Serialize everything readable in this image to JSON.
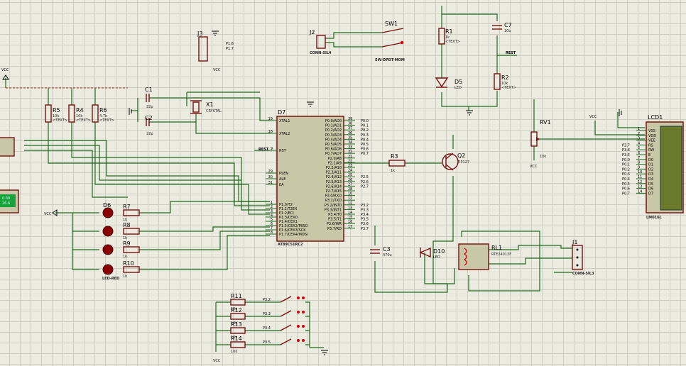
{
  "components": [
    {
      "ref": "R1",
      "value": "1k"
    },
    {
      "ref": "R2",
      "value": "10k"
    },
    {
      "ref": "R3",
      "value": "1k"
    },
    {
      "ref": "R4",
      "value": "10k"
    },
    {
      "ref": "R5",
      "value": "10k"
    },
    {
      "ref": "R6",
      "value": "4.7k"
    },
    {
      "ref": "R7",
      "value": "1k"
    },
    {
      "ref": "R8",
      "value": "1k"
    },
    {
      "ref": "R9",
      "value": "1k"
    },
    {
      "ref": "R10",
      "value": "1k"
    },
    {
      "ref": "R11",
      "value": "10k"
    },
    {
      "ref": "R12",
      "value": "10k"
    },
    {
      "ref": "R13",
      "value": "10k"
    },
    {
      "ref": "R14",
      "value": "10k"
    },
    {
      "ref": "C1",
      "value": "22p"
    },
    {
      "ref": "C2",
      "value": "22p"
    },
    {
      "ref": "C3",
      "value": "470u"
    },
    {
      "ref": "C7",
      "value": "10u"
    },
    {
      "ref": "X1",
      "value": "CRYSTAL"
    },
    {
      "ref": "Q2",
      "value": "TIP127"
    },
    {
      "ref": "RV1",
      "value": "10k"
    },
    {
      "ref": "D5",
      "value": "LED"
    },
    {
      "ref": "D6",
      "value": "LED-RED"
    },
    {
      "ref": "D7",
      "value": "LED-RED"
    },
    {
      "ref": "D8",
      "value": "LED-RED"
    },
    {
      "ref": "D9",
      "value": "LED-RED"
    },
    {
      "ref": "D10",
      "value": "LED"
    },
    {
      "ref": "J1",
      "value": "CONN-SIL3"
    },
    {
      "ref": "J2",
      "value": "CONN-SIL2"
    },
    {
      "ref": "J3",
      "value": "CONN-SIL4"
    },
    {
      "ref": "SW1",
      "value": "SW-DPDT-MOM"
    },
    {
      "ref": "RL1",
      "value": "RTE24012F"
    },
    {
      "ref": "D7",
      "value": "AT89C51RC2"
    },
    {
      "ref": "LCD1",
      "value": "LM016L"
    }
  ],
  "labels": {
    "text_placeholder": "<TEXT>",
    "vcc": "VCC",
    "rest": "REST",
    "rst": "RST",
    "p16": "P1.6",
    "p17": "P1.7",
    "p32": "P3.2",
    "p33": "P3.3",
    "p34": "P3.4",
    "p35": "P3.5",
    "p06": "P0.6",
    "p07": "P0.7",
    "p37": "P3.7",
    "p36": "P3.6"
  },
  "mcu": {
    "left_pins": [
      "XTAL1",
      "XTAL2",
      "RST",
      "PSEN",
      "ALE",
      "EA",
      "P1.0/T2",
      "P1.1/T2EX",
      "P1.2/ECI",
      "P1.3/CEX0",
      "P1.4/CEX1",
      "P1.5/CEX2/MISO",
      "P1.6/CEX3/SCK",
      "P1.7/CEX4/MOSI"
    ],
    "left_nums": [
      "19",
      "18",
      "9",
      "29",
      "30",
      "31",
      "1",
      "2",
      "3",
      "4",
      "5",
      "6",
      "7",
      "8"
    ],
    "right_pins": [
      "P0.0/AD0",
      "P0.1/AD1",
      "P0.2/AD2",
      "P0.3/AD3",
      "P0.4/AD4",
      "P0.5/AD5",
      "P0.6/AD6",
      "P0.7/AD7",
      "P2.0/A8",
      "P2.1/A9",
      "P2.2/A10",
      "P2.3/A11",
      "P2.4/A12",
      "P2.5/A13",
      "P2.6/A14",
      "P2.7/A15",
      "P3.0/RXD",
      "P3.1/TXD",
      "P3.2/INT0",
      "P3.3/INT1",
      "P3.4/T0",
      "P3.5/T1",
      "P3.6/WR",
      "P3.7/RD"
    ],
    "right_nums": [
      "39",
      "38",
      "37",
      "36",
      "35",
      "34",
      "33",
      "32",
      "21",
      "22",
      "23",
      "24",
      "25",
      "26",
      "27",
      "28",
      "10",
      "11",
      "12",
      "13",
      "14",
      "15",
      "16",
      "17"
    ],
    "right_nets": [
      "P0.0",
      "P0.1",
      "P0.2",
      "P0.3",
      "P0.4",
      "P0.5",
      "P0.6",
      "P0.7",
      "",
      "",
      "",
      "",
      "P2.5",
      "P2.6",
      "P2.7",
      "",
      "",
      "",
      "P3.2",
      "P3.3",
      "P3.4",
      "P3.5",
      "P3.6",
      "P3.7"
    ]
  },
  "lcd": {
    "pins": [
      "VSS",
      "VDD",
      "VEE",
      "RS",
      "RW",
      "E",
      "D0",
      "D1",
      "D2",
      "D3",
      "D4",
      "D5",
      "D6",
      "D7"
    ],
    "nums": [
      "1",
      "2",
      "3",
      "4",
      "5",
      "6",
      "7",
      "8",
      "9",
      "10",
      "11",
      "12",
      "13",
      "14"
    ],
    "nets": [
      "",
      "",
      "",
      "P3.7",
      "P3.6",
      "P3.5",
      "P0.0",
      "P0.1",
      "P0.2",
      "P0.3",
      "P0.4",
      "P0.5",
      "P0.6",
      "P0.7"
    ]
  },
  "display": {
    "line1": "0.00",
    "line2": "26.6"
  }
}
